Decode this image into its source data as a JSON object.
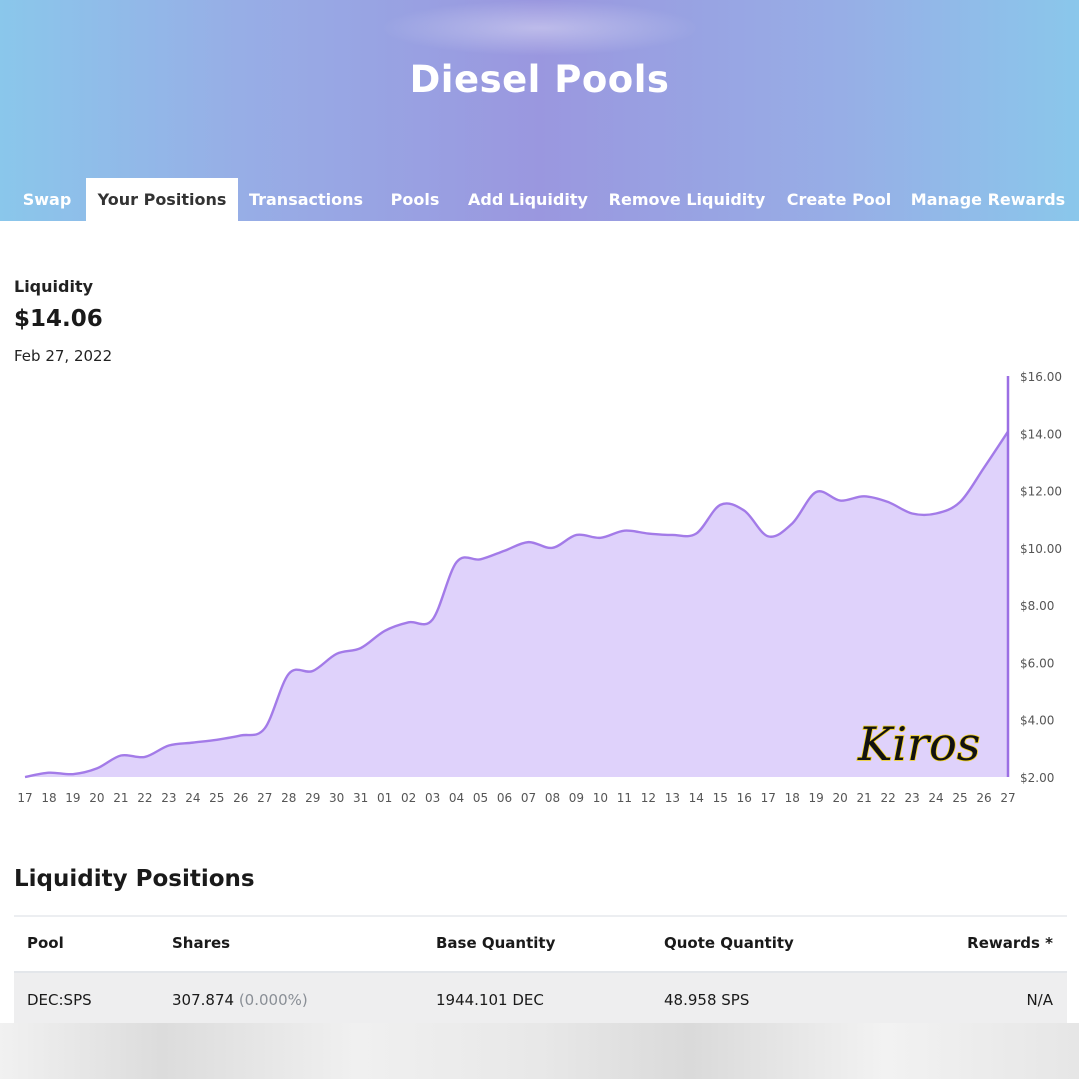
{
  "app": {
    "title": "Diesel Pools"
  },
  "tabs": [
    {
      "label": "Swap"
    },
    {
      "label": "Your Positions",
      "active": true
    },
    {
      "label": "Transactions"
    },
    {
      "label": "Pools"
    },
    {
      "label": "Add Liquidity"
    },
    {
      "label": "Remove Liquidity"
    },
    {
      "label": "Create Pool"
    },
    {
      "label": "Manage Rewards"
    }
  ],
  "summary": {
    "label": "Liquidity",
    "value": "$14.06",
    "date": "Feb 27, 2022"
  },
  "chart_data": {
    "type": "area",
    "x": [
      "17",
      "18",
      "19",
      "20",
      "21",
      "22",
      "23",
      "24",
      "25",
      "26",
      "27",
      "28",
      "29",
      "30",
      "31",
      "01",
      "02",
      "03",
      "04",
      "05",
      "06",
      "07",
      "08",
      "09",
      "10",
      "11",
      "12",
      "13",
      "14",
      "15",
      "16",
      "17",
      "18",
      "19",
      "20",
      "21",
      "22",
      "23",
      "24",
      "25",
      "26",
      "27"
    ],
    "values": [
      2.0,
      2.15,
      2.1,
      2.3,
      2.75,
      2.7,
      3.1,
      3.2,
      3.3,
      3.45,
      3.7,
      5.6,
      5.7,
      6.3,
      6.5,
      7.1,
      7.4,
      7.5,
      9.5,
      9.6,
      9.9,
      10.2,
      10.0,
      10.45,
      10.35,
      10.6,
      10.5,
      10.45,
      10.5,
      11.5,
      11.3,
      10.4,
      10.85,
      11.95,
      11.65,
      11.8,
      11.6,
      11.2,
      11.2,
      11.6,
      12.8,
      14.06
    ],
    "yticks": [
      "$2.00",
      "$4.00",
      "$6.00",
      "$8.00",
      "$10.00",
      "$12.00",
      "$14.00",
      "$16.00"
    ],
    "ylim": [
      2,
      16
    ],
    "colors": {
      "line": "#a37be8",
      "fill": "#dfd2fb",
      "cursor": "#9b6fe4"
    },
    "annotation": "Kiros",
    "grid": false
  },
  "positions": {
    "title": "Liquidity Positions",
    "columns": [
      "Pool",
      "Shares",
      "Base Quantity",
      "Quote Quantity",
      "Rewards *"
    ],
    "rows": [
      {
        "pool": "DEC:SPS",
        "shares": "307.874",
        "share_pct": "(0.000%)",
        "base": "1944.101 DEC",
        "quote": "48.958 SPS",
        "rewards": "N/A"
      }
    ]
  }
}
